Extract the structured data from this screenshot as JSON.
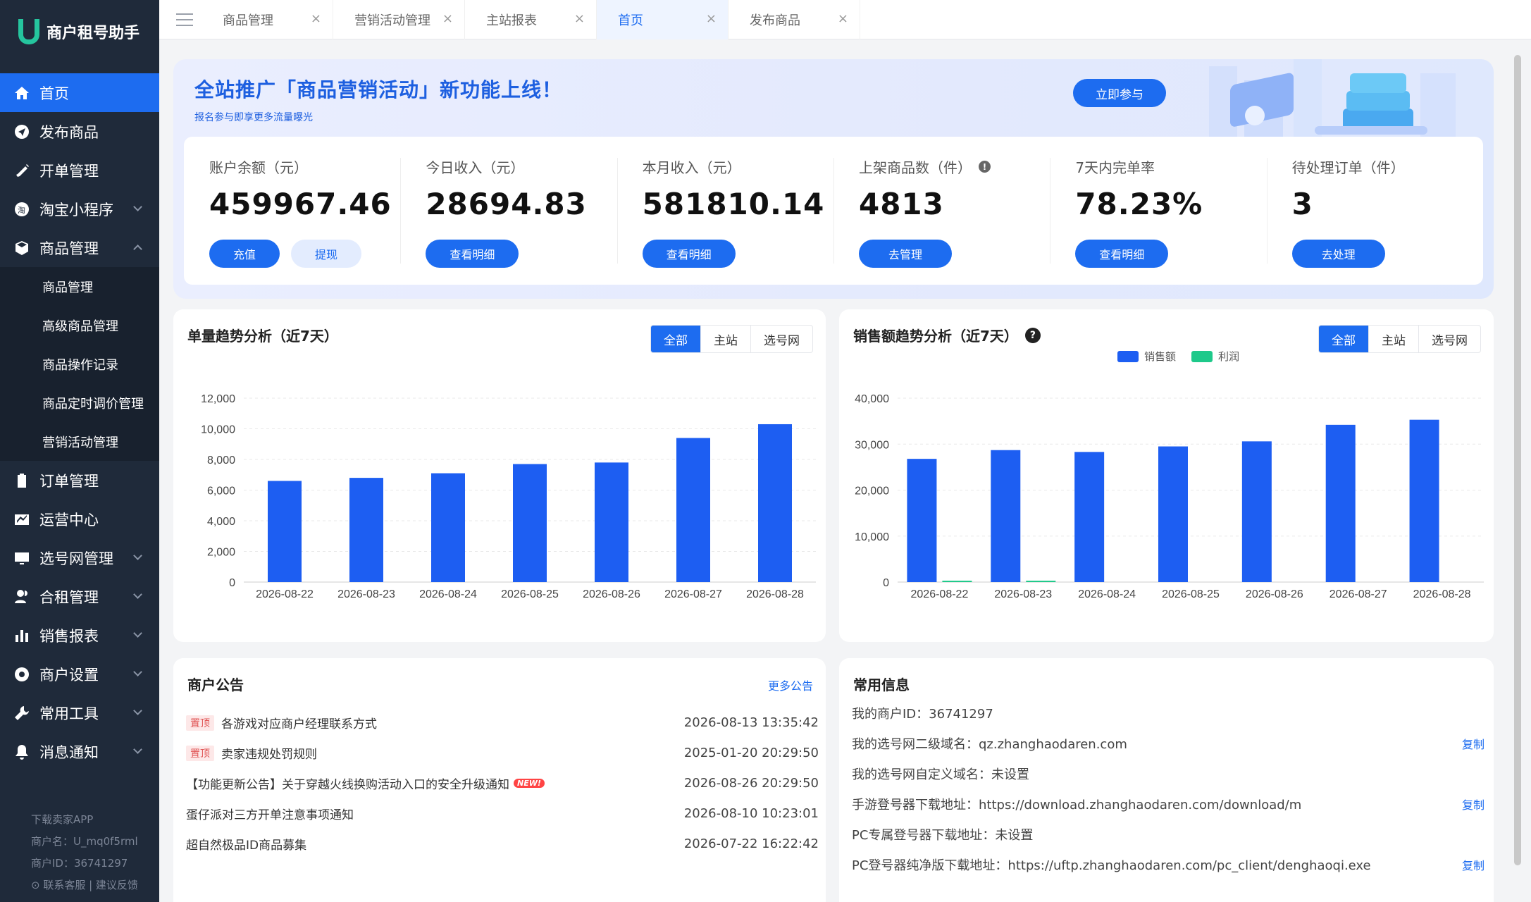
{
  "app": {
    "name": "商户租号助手",
    "accent": "#1d6cf0",
    "brand": "#25c59e"
  },
  "sidebar": {
    "items": [
      {
        "label": "首页",
        "icon": "home-icon",
        "active": true
      },
      {
        "label": "发布商品",
        "icon": "send-icon"
      },
      {
        "label": "开单管理",
        "icon": "pencil-icon"
      },
      {
        "label": "淘宝小程序",
        "icon": "taobao-icon",
        "expandable": true
      },
      {
        "label": "商品管理",
        "icon": "box-icon",
        "expanded": true
      },
      {
        "label": "订单管理",
        "icon": "clipboard-icon"
      },
      {
        "label": "运营中心",
        "icon": "chart-line-icon"
      },
      {
        "label": "选号网管理",
        "icon": "monitor-icon",
        "expandable": true
      },
      {
        "label": "合租管理",
        "icon": "users-icon",
        "expandable": true
      },
      {
        "label": "销售报表",
        "icon": "bar-chart-icon",
        "expandable": true
      },
      {
        "label": "商户设置",
        "icon": "gear-icon",
        "expandable": true
      },
      {
        "label": "常用工具",
        "icon": "wrench-icon",
        "expandable": true
      },
      {
        "label": "消息通知",
        "icon": "bell-icon",
        "expandable": true
      }
    ],
    "subitems": [
      "商品管理",
      "高级商品管理",
      "商品操作记录",
      "商品定时调价管理",
      "营销活动管理"
    ],
    "footer": {
      "download": "下载卖家APP",
      "merchant_name": "商户名：U_mq0f5rml",
      "merchant_id": "商户ID：36741297",
      "links": "联系客服 | 建议反馈"
    }
  },
  "tabs": [
    {
      "label": "商品管理"
    },
    {
      "label": "营销活动管理"
    },
    {
      "label": "主站报表"
    },
    {
      "label": "首页",
      "active": true
    },
    {
      "label": "发布商品"
    }
  ],
  "banner": {
    "title": "全站推广「商品营销活动」新功能上线！",
    "subtitle": "报名参与即享更多流量曝光",
    "button": "立即参与"
  },
  "stats": [
    {
      "label": "账户余额（元）",
      "value": "459967.46",
      "buttons": [
        "充值",
        "提现"
      ]
    },
    {
      "label": "今日收入（元）",
      "value": "28694.83",
      "buttons": [
        "查看明细"
      ]
    },
    {
      "label": "本月收入（元）",
      "value": "581810.14",
      "buttons": [
        "查看明细"
      ]
    },
    {
      "label": "上架商品数（件）",
      "value": "4813",
      "buttons": [
        "去管理"
      ],
      "info": true
    },
    {
      "label": "7天内完单率",
      "value": "78.23%",
      "buttons": [
        "查看明细"
      ]
    },
    {
      "label": "待处理订单（件）",
      "value": "3",
      "buttons": [
        "去处理"
      ]
    }
  ],
  "order_chart": {
    "title": "单量趋势分析（近7天）",
    "filters": [
      "全部",
      "主站",
      "选号网"
    ],
    "active_filter": "全部"
  },
  "sales_chart": {
    "title": "销售额趋势分析（近7天）",
    "filters": [
      "全部",
      "主站",
      "选号网"
    ],
    "active_filter": "全部",
    "legend": [
      "销售额",
      "利润"
    ]
  },
  "chart_data": [
    {
      "type": "bar",
      "categories": [
        "2026-08-22",
        "2026-08-23",
        "2026-08-24",
        "2026-08-25",
        "2026-08-26",
        "2026-08-27",
        "2026-08-28"
      ],
      "values": [
        6600,
        6800,
        7100,
        7700,
        7800,
        9400,
        10300
      ],
      "ylim": [
        0,
        12000
      ],
      "yticks": [
        "0",
        "2,000",
        "4,000",
        "6,000",
        "8,000",
        "10,000",
        "12,000"
      ],
      "grid": true,
      "color": "#1d5ef2"
    },
    {
      "type": "bar",
      "categories": [
        "2026-08-22",
        "2026-08-23",
        "2026-08-24",
        "2026-08-25",
        "2026-08-26",
        "2026-08-27",
        "2026-08-28"
      ],
      "series": [
        {
          "name": "销售额",
          "values": [
            26800,
            28700,
            28300,
            29500,
            30600,
            34200,
            35300
          ],
          "color": "#1d5ef2"
        },
        {
          "name": "利润",
          "values": [
            300,
            300,
            0,
            0,
            0,
            0,
            0
          ],
          "color": "#1ec98a"
        }
      ],
      "ylim": [
        0,
        40000
      ],
      "yticks": [
        "0",
        "10,000",
        "20,000",
        "30,000",
        "40,000"
      ],
      "grid": true,
      "legend_position": "top"
    }
  ],
  "announcements": {
    "title": "商户公告",
    "more": "更多公告",
    "items": [
      {
        "tag": "置顶",
        "text": "各游戏对应商户经理联系方式",
        "date": "2026-08-13 13:35:42"
      },
      {
        "tag": "置顶",
        "text": "卖家违规处罚规则",
        "date": "2025-01-20 20:29:50"
      },
      {
        "text": "【功能更新公告】关于穿越火线换购活动入口的安全升级通知",
        "badge": "NEW!",
        "date": "2026-08-26 20:29:50"
      },
      {
        "text": "蛋仔派对三方开单注意事项通知",
        "date": "2026-08-10 10:23:01"
      },
      {
        "text": "超自然极品ID商品募集",
        "date": "2026-07-22 16:22:42"
      }
    ]
  },
  "common_info": {
    "title": "常用信息",
    "copy": "复制",
    "rows": [
      {
        "text": "我的商户ID：36741297"
      },
      {
        "text": "我的选号网二级域名：qz.zhanghaodaren.com",
        "copy": true
      },
      {
        "text": "我的选号网自定义域名：未设置"
      },
      {
        "text": "手游登号器下载地址：https://download.zhanghaodaren.com/download/m",
        "copy": true
      },
      {
        "text": "PC专属登号器下载地址：未设置"
      },
      {
        "text": "PC登号器纯净版下载地址：https://uftp.zhanghaodaren.com/pc_client/denghaoqi.exe",
        "copy": true
      }
    ]
  }
}
